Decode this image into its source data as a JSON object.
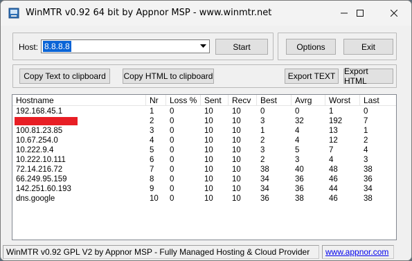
{
  "window": {
    "title": "WinMTR v0.92 64 bit by Appnor MSP - www.winmtr.net",
    "minimize_glyph": "—",
    "maximize_glyph": "☐",
    "close_glyph": "✕"
  },
  "host": {
    "label": "Host:",
    "value": "8.8.8.8"
  },
  "buttons": {
    "start": "Start",
    "options": "Options",
    "exit": "Exit",
    "copy_text": "Copy Text to clipboard",
    "copy_html": "Copy HTML to clipboard",
    "export_text": "Export TEXT",
    "export_html": "Export HTML"
  },
  "table": {
    "headers": [
      "Hostname",
      "Nr",
      "Loss %",
      "Sent",
      "Recv",
      "Best",
      "Avrg",
      "Worst",
      "Last"
    ],
    "rows": [
      {
        "host": "192.168.45.1",
        "nr": "1",
        "loss": "0",
        "sent": "10",
        "recv": "10",
        "best": "0",
        "avrg": "0",
        "worst": "1",
        "last": "0",
        "redacted": false
      },
      {
        "host": "",
        "nr": "2",
        "loss": "0",
        "sent": "10",
        "recv": "10",
        "best": "3",
        "avrg": "32",
        "worst": "192",
        "last": "7",
        "redacted": true
      },
      {
        "host": "100.81.23.85",
        "nr": "3",
        "loss": "0",
        "sent": "10",
        "recv": "10",
        "best": "1",
        "avrg": "4",
        "worst": "13",
        "last": "1",
        "redacted": false
      },
      {
        "host": "10.67.254.0",
        "nr": "4",
        "loss": "0",
        "sent": "10",
        "recv": "10",
        "best": "2",
        "avrg": "4",
        "worst": "12",
        "last": "2",
        "redacted": false
      },
      {
        "host": "10.222.9.4",
        "nr": "5",
        "loss": "0",
        "sent": "10",
        "recv": "10",
        "best": "3",
        "avrg": "5",
        "worst": "7",
        "last": "4",
        "redacted": false
      },
      {
        "host": "10.222.10.111",
        "nr": "6",
        "loss": "0",
        "sent": "10",
        "recv": "10",
        "best": "2",
        "avrg": "3",
        "worst": "4",
        "last": "3",
        "redacted": false
      },
      {
        "host": "72.14.216.72",
        "nr": "7",
        "loss": "0",
        "sent": "10",
        "recv": "10",
        "best": "38",
        "avrg": "40",
        "worst": "48",
        "last": "38",
        "redacted": false
      },
      {
        "host": "66.249.95.159",
        "nr": "8",
        "loss": "0",
        "sent": "10",
        "recv": "10",
        "best": "34",
        "avrg": "36",
        "worst": "46",
        "last": "36",
        "redacted": false
      },
      {
        "host": "142.251.60.193",
        "nr": "9",
        "loss": "0",
        "sent": "10",
        "recv": "10",
        "best": "34",
        "avrg": "36",
        "worst": "44",
        "last": "34",
        "redacted": false
      },
      {
        "host": "dns.google",
        "nr": "10",
        "loss": "0",
        "sent": "10",
        "recv": "10",
        "best": "36",
        "avrg": "38",
        "worst": "46",
        "last": "38",
        "redacted": false
      }
    ]
  },
  "status": {
    "text": "WinMTR v0.92 GPL V2 by Appnor MSP - Fully Managed Hosting & Cloud Provider",
    "link": "www.appnor.com"
  },
  "colors": {
    "selection": "#0a64d6",
    "redaction": "#e81e25",
    "link": "#0000ee"
  }
}
